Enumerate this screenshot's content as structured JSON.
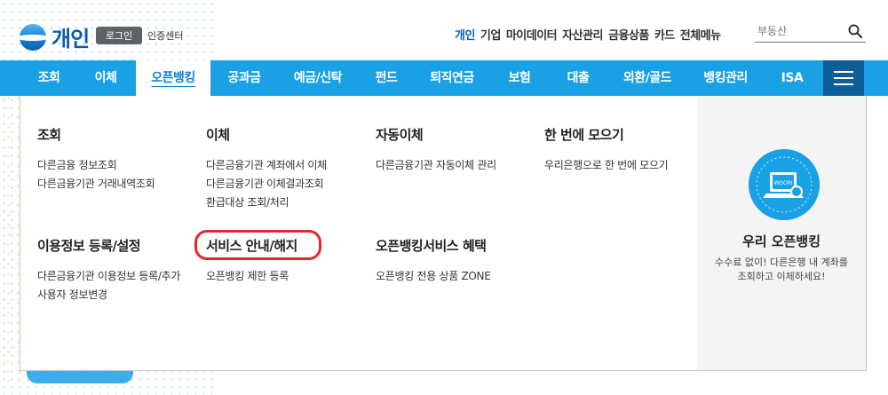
{
  "header": {
    "logo_text": "개인",
    "login_label": "로그인",
    "cert_label": "인증센터",
    "util_nav": [
      "개인",
      "기업",
      "마이데이터",
      "자산관리",
      "금융상품",
      "카드",
      "전체메뉴"
    ],
    "search_placeholder": "부동산"
  },
  "gnb": {
    "items": [
      "조회",
      "이체",
      "오픈뱅킹",
      "공과금",
      "예금/신탁",
      "펀드",
      "퇴직연금",
      "보험",
      "대출",
      "외환/골드",
      "뱅킹관리",
      "ISA"
    ],
    "active": "오픈뱅킹"
  },
  "menu": {
    "groups": [
      {
        "title": "조회",
        "links": [
          "다른금융 정보조회",
          "다른금융기관 거래내역조회"
        ]
      },
      {
        "title": "이체",
        "links": [
          "다른금융기관 계좌에서 이체",
          "다른금융기관 이체결과조회",
          "환급대상 조회/처리"
        ]
      },
      {
        "title": "자동이체",
        "links": [
          "다른금융기관 자동이체 관리"
        ]
      },
      {
        "title": "한 번에 모으기",
        "links": [
          "우리은행으로 한 번에 모으기"
        ]
      },
      {
        "title": "이용정보 등록/설정",
        "links": [
          "다른금융기관 이용정보 등록/추가",
          "사용자 정보변경"
        ]
      },
      {
        "title": "서비스 안내/해지",
        "links": [
          "오픈뱅킹 제한 등록"
        ]
      },
      {
        "title": "오픈뱅킹서비스 혜택",
        "links": [
          "오픈뱅킹 전용 상품 ZONE"
        ]
      }
    ]
  },
  "promo": {
    "icon_text": "WOORI",
    "title": "우리 오픈뱅킹",
    "desc_line1": "수수료 없이! 다른은행 내 계좌를",
    "desc_line2": "조회하고 이체하세요!"
  },
  "colors": {
    "brand_blue": "#1aa0e4",
    "nav_dark": "#0d5d96",
    "highlight_red": "#e0282e",
    "active_text": "#0a63b5"
  }
}
